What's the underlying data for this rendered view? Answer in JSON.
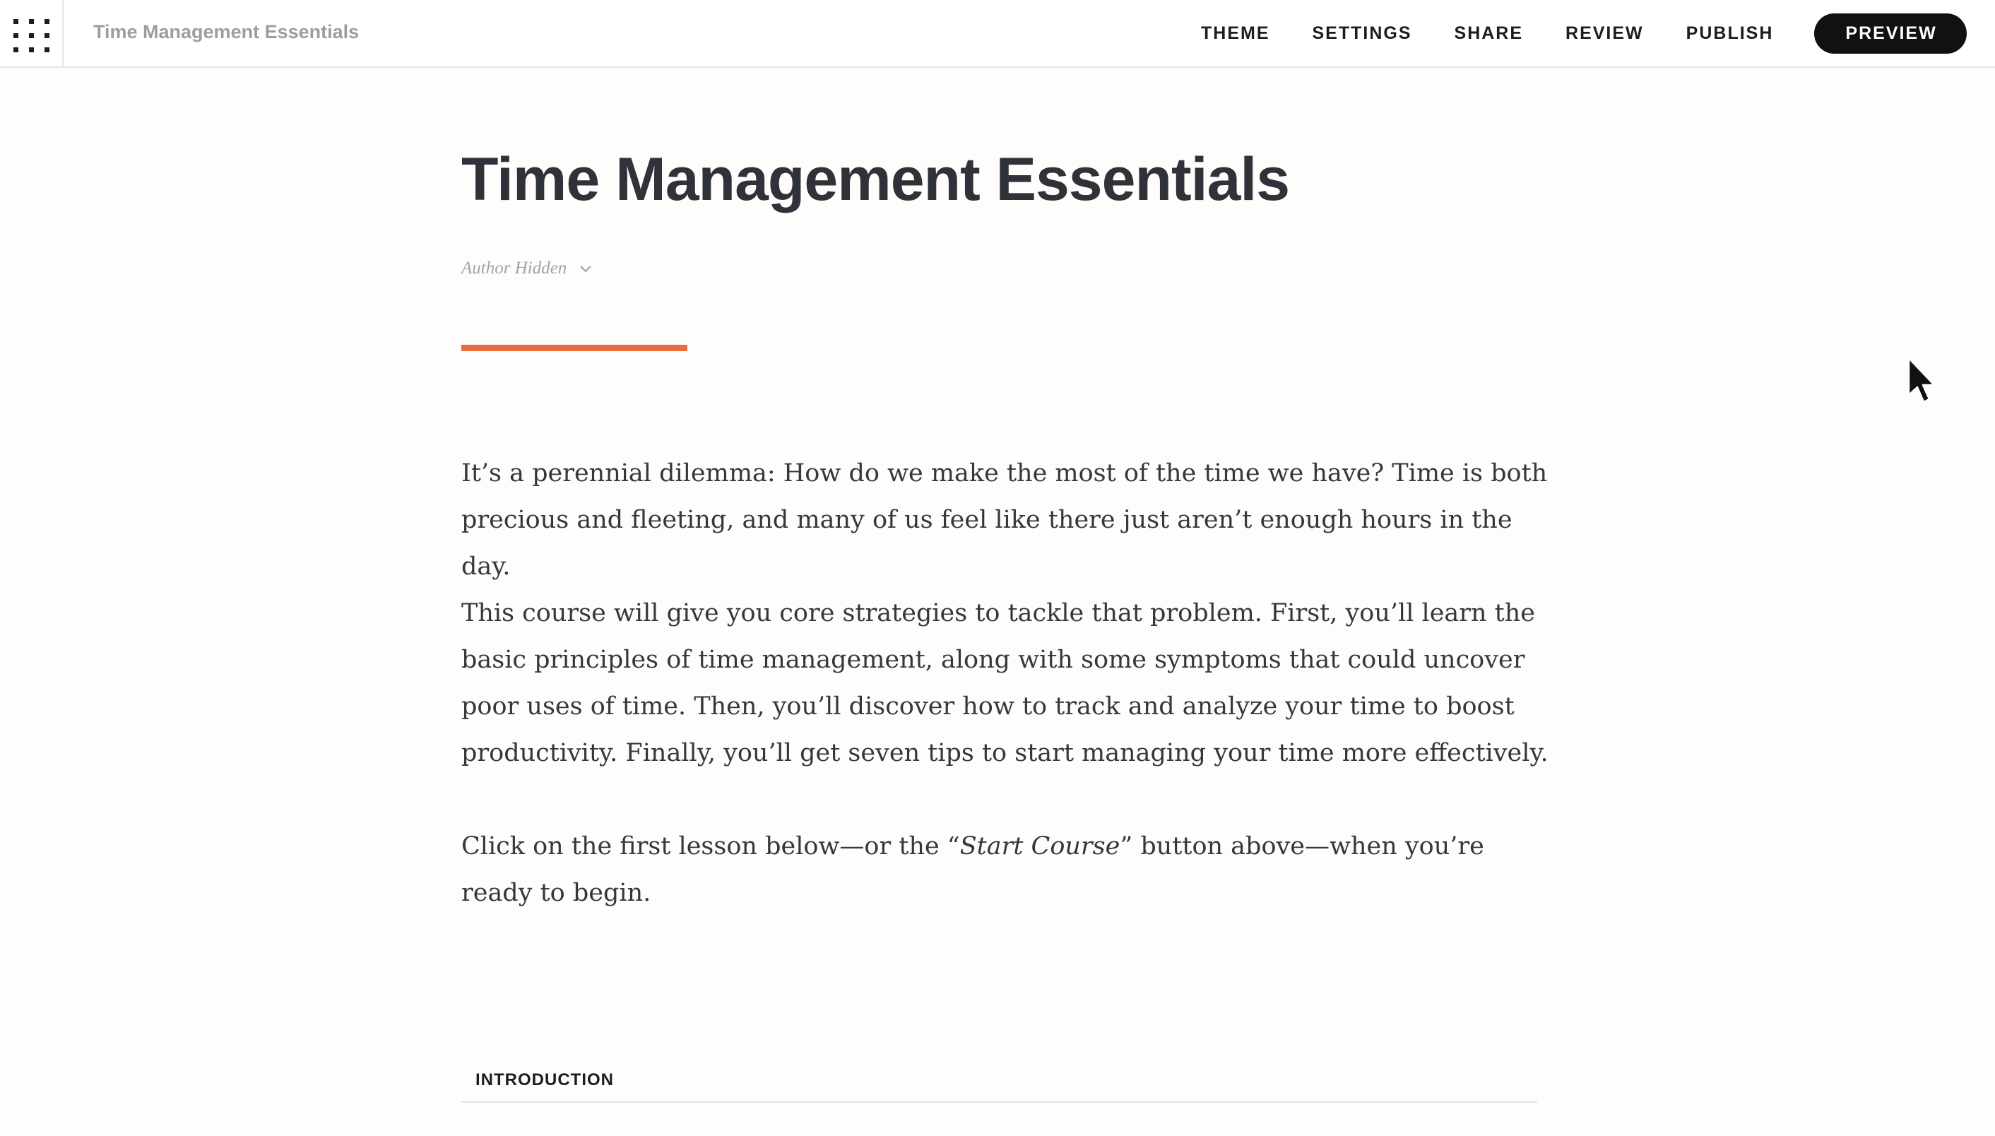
{
  "header": {
    "apps_icon": "grid-menu-icon",
    "course_name": "Time Management Essentials",
    "nav": {
      "theme": "THEME",
      "settings": "SETTINGS",
      "share": "SHARE",
      "review": "REVIEW",
      "publish": "PUBLISH",
      "preview": "PREVIEW"
    }
  },
  "course": {
    "title": "Time Management Essentials",
    "author_label": "Author Hidden",
    "author_icon": "chevron-down-icon",
    "accent_color": "#e96e3f",
    "description": {
      "p1": "It’s a perennial dilemma: How do we make the most of the time we have? Time is both precious and fleeting, and many of us feel like there just aren’t enough hours in the day.",
      "p2": "This course will give you core strategies to tackle that problem.  First, you’ll learn the basic principles of time management, along with some symptoms that could uncover  poor uses of time. Then, you’ll discover how to track and analyze your time to boost productivity. Finally, you’ll get seven tips to start managing your time more effectively.",
      "p3_before": "Click on the first lesson below—or the “",
      "p3_italic": "Start Course",
      "p3_after": "” button above—when you’re ready to begin."
    },
    "section_label": "INTRODUCTION"
  }
}
